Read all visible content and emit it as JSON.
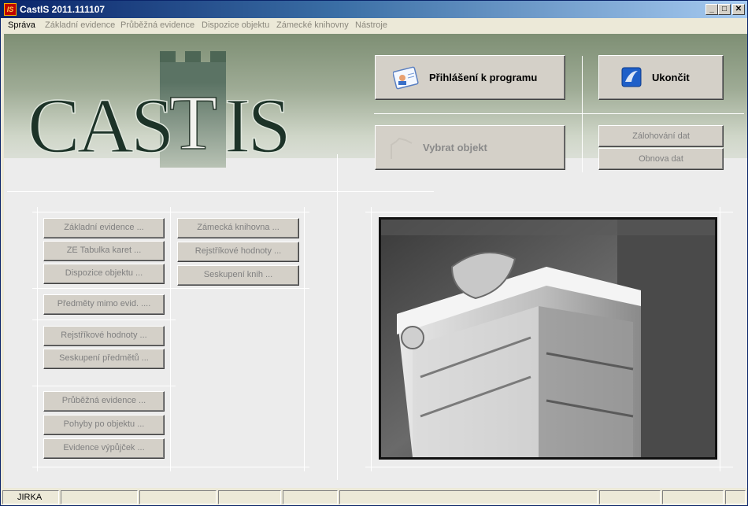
{
  "window": {
    "title": "CastIS 2011.111107",
    "app_icon_text": "IS"
  },
  "titlebar_buttons": {
    "minimize": "_",
    "maximize": "□",
    "close": "✕"
  },
  "menu": [
    "Správa",
    "Základní evidence",
    "Průběžná evidence",
    "Dispozice objektu",
    "Zámecké knihovny",
    "Nástroje"
  ],
  "logo": {
    "text_left": "CAS",
    "text_mid": "T",
    "text_right": "IS"
  },
  "top_buttons": {
    "login": "Přihlášení k programu",
    "exit": "Ukončit",
    "select_object": "Vybrat objekt",
    "backup": "Zálohování dat",
    "restore": "Obnova dat"
  },
  "nav_col1": {
    "group1": [
      "Základní evidence ...",
      "ZE Tabulka karet ...",
      "Dispozice objektu ..."
    ],
    "group2": [
      "Předměty mimo evid. ...."
    ],
    "group3": [
      "Rejstříkové hodnoty ...",
      "Seskupení předmětů ..."
    ],
    "group4": [
      "Průběžná evidence ...",
      "Pohyby po objektu ...",
      "Evidence výpůjček ..."
    ]
  },
  "nav_col2": [
    "Zámecká knihovna ...",
    "Rejstříkové hodnoty ...",
    "Seskupení knih ..."
  ],
  "status": {
    "user": "JIRKA"
  },
  "colors": {
    "title_start": "#0a246a",
    "title_end": "#a6caf0",
    "logo_green": "#4d6655"
  }
}
